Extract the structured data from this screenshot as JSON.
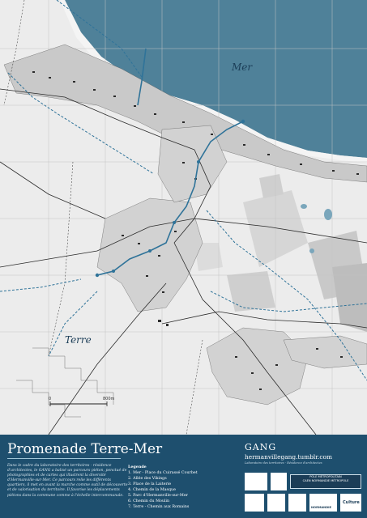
{
  "map": {
    "sea_label": "Mer",
    "land_label": "Terre",
    "scale_start": "0",
    "scale_end": "800m",
    "colors": {
      "sea": "#4f8199",
      "land": "#ececec",
      "route": "#2f7399",
      "roads": "#2b2b2b"
    }
  },
  "footer": {
    "title": "Promenade Terre-Mer",
    "intro": "Dans le cadre du laboratoire des territoires - résidence d'architectes, le GANG a balisé un parcours piéton, ponctué de photographies et de cartes qui illustrent la diversité d'Hermanville-sur-Mer. Ce parcours relie les différents quartiers, il met en avant la marche comme outil de découverte et de valorisation du territoire. Il favorise les déplacements piétons dans la commune comme à l'échelle intercommunale.",
    "legend_title": "Legende",
    "legend_items": [
      "1. Mer - Place du Cuirassé Courbet",
      "2. Allée des Vikings",
      "3. Place de la Laiterie",
      "4. Chemin de la Masque",
      "5. Parc d'Hermanville-sur-Mer",
      "6. Chemin du Moulin",
      "7. Terre - Chemin aux Romains"
    ],
    "brand": "GANG",
    "website": "hermanvillegang.tumblr.com",
    "subtitle": "Laboratoire des territoires  -  Résidence d'architectes",
    "logos": {
      "pole_line1": "PÔLE MÉTROPOLITAIN",
      "pole_line2": "CAEN NORMANDIE MÉTROPOLE",
      "region": "NORMANDIE",
      "culture": "Culture"
    }
  }
}
